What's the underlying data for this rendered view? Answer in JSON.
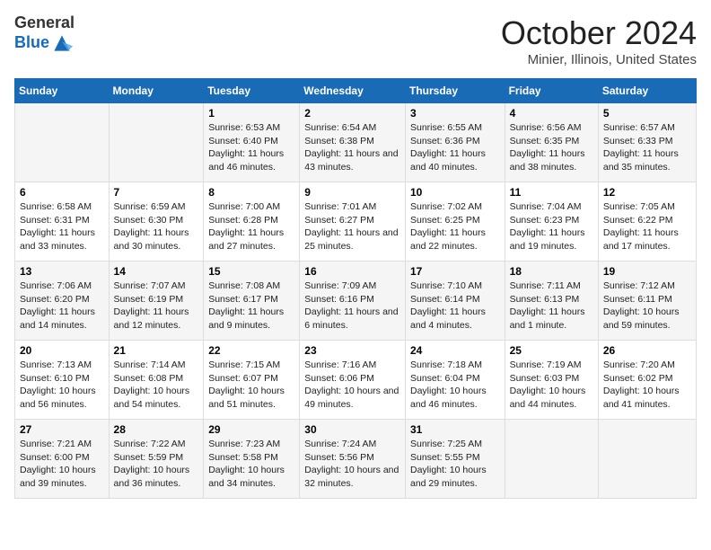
{
  "logo": {
    "general": "General",
    "blue": "Blue"
  },
  "header": {
    "month": "October 2024",
    "location": "Minier, Illinois, United States"
  },
  "weekdays": [
    "Sunday",
    "Monday",
    "Tuesday",
    "Wednesday",
    "Thursday",
    "Friday",
    "Saturday"
  ],
  "weeks": [
    [
      {
        "day": "",
        "info": ""
      },
      {
        "day": "",
        "info": ""
      },
      {
        "day": "1",
        "info": "Sunrise: 6:53 AM\nSunset: 6:40 PM\nDaylight: 11 hours and 46 minutes."
      },
      {
        "day": "2",
        "info": "Sunrise: 6:54 AM\nSunset: 6:38 PM\nDaylight: 11 hours and 43 minutes."
      },
      {
        "day": "3",
        "info": "Sunrise: 6:55 AM\nSunset: 6:36 PM\nDaylight: 11 hours and 40 minutes."
      },
      {
        "day": "4",
        "info": "Sunrise: 6:56 AM\nSunset: 6:35 PM\nDaylight: 11 hours and 38 minutes."
      },
      {
        "day": "5",
        "info": "Sunrise: 6:57 AM\nSunset: 6:33 PM\nDaylight: 11 hours and 35 minutes."
      }
    ],
    [
      {
        "day": "6",
        "info": "Sunrise: 6:58 AM\nSunset: 6:31 PM\nDaylight: 11 hours and 33 minutes."
      },
      {
        "day": "7",
        "info": "Sunrise: 6:59 AM\nSunset: 6:30 PM\nDaylight: 11 hours and 30 minutes."
      },
      {
        "day": "8",
        "info": "Sunrise: 7:00 AM\nSunset: 6:28 PM\nDaylight: 11 hours and 27 minutes."
      },
      {
        "day": "9",
        "info": "Sunrise: 7:01 AM\nSunset: 6:27 PM\nDaylight: 11 hours and 25 minutes."
      },
      {
        "day": "10",
        "info": "Sunrise: 7:02 AM\nSunset: 6:25 PM\nDaylight: 11 hours and 22 minutes."
      },
      {
        "day": "11",
        "info": "Sunrise: 7:04 AM\nSunset: 6:23 PM\nDaylight: 11 hours and 19 minutes."
      },
      {
        "day": "12",
        "info": "Sunrise: 7:05 AM\nSunset: 6:22 PM\nDaylight: 11 hours and 17 minutes."
      }
    ],
    [
      {
        "day": "13",
        "info": "Sunrise: 7:06 AM\nSunset: 6:20 PM\nDaylight: 11 hours and 14 minutes."
      },
      {
        "day": "14",
        "info": "Sunrise: 7:07 AM\nSunset: 6:19 PM\nDaylight: 11 hours and 12 minutes."
      },
      {
        "day": "15",
        "info": "Sunrise: 7:08 AM\nSunset: 6:17 PM\nDaylight: 11 hours and 9 minutes."
      },
      {
        "day": "16",
        "info": "Sunrise: 7:09 AM\nSunset: 6:16 PM\nDaylight: 11 hours and 6 minutes."
      },
      {
        "day": "17",
        "info": "Sunrise: 7:10 AM\nSunset: 6:14 PM\nDaylight: 11 hours and 4 minutes."
      },
      {
        "day": "18",
        "info": "Sunrise: 7:11 AM\nSunset: 6:13 PM\nDaylight: 11 hours and 1 minute."
      },
      {
        "day": "19",
        "info": "Sunrise: 7:12 AM\nSunset: 6:11 PM\nDaylight: 10 hours and 59 minutes."
      }
    ],
    [
      {
        "day": "20",
        "info": "Sunrise: 7:13 AM\nSunset: 6:10 PM\nDaylight: 10 hours and 56 minutes."
      },
      {
        "day": "21",
        "info": "Sunrise: 7:14 AM\nSunset: 6:08 PM\nDaylight: 10 hours and 54 minutes."
      },
      {
        "day": "22",
        "info": "Sunrise: 7:15 AM\nSunset: 6:07 PM\nDaylight: 10 hours and 51 minutes."
      },
      {
        "day": "23",
        "info": "Sunrise: 7:16 AM\nSunset: 6:06 PM\nDaylight: 10 hours and 49 minutes."
      },
      {
        "day": "24",
        "info": "Sunrise: 7:18 AM\nSunset: 6:04 PM\nDaylight: 10 hours and 46 minutes."
      },
      {
        "day": "25",
        "info": "Sunrise: 7:19 AM\nSunset: 6:03 PM\nDaylight: 10 hours and 44 minutes."
      },
      {
        "day": "26",
        "info": "Sunrise: 7:20 AM\nSunset: 6:02 PM\nDaylight: 10 hours and 41 minutes."
      }
    ],
    [
      {
        "day": "27",
        "info": "Sunrise: 7:21 AM\nSunset: 6:00 PM\nDaylight: 10 hours and 39 minutes."
      },
      {
        "day": "28",
        "info": "Sunrise: 7:22 AM\nSunset: 5:59 PM\nDaylight: 10 hours and 36 minutes."
      },
      {
        "day": "29",
        "info": "Sunrise: 7:23 AM\nSunset: 5:58 PM\nDaylight: 10 hours and 34 minutes."
      },
      {
        "day": "30",
        "info": "Sunrise: 7:24 AM\nSunset: 5:56 PM\nDaylight: 10 hours and 32 minutes."
      },
      {
        "day": "31",
        "info": "Sunrise: 7:25 AM\nSunset: 5:55 PM\nDaylight: 10 hours and 29 minutes."
      },
      {
        "day": "",
        "info": ""
      },
      {
        "day": "",
        "info": ""
      }
    ]
  ]
}
